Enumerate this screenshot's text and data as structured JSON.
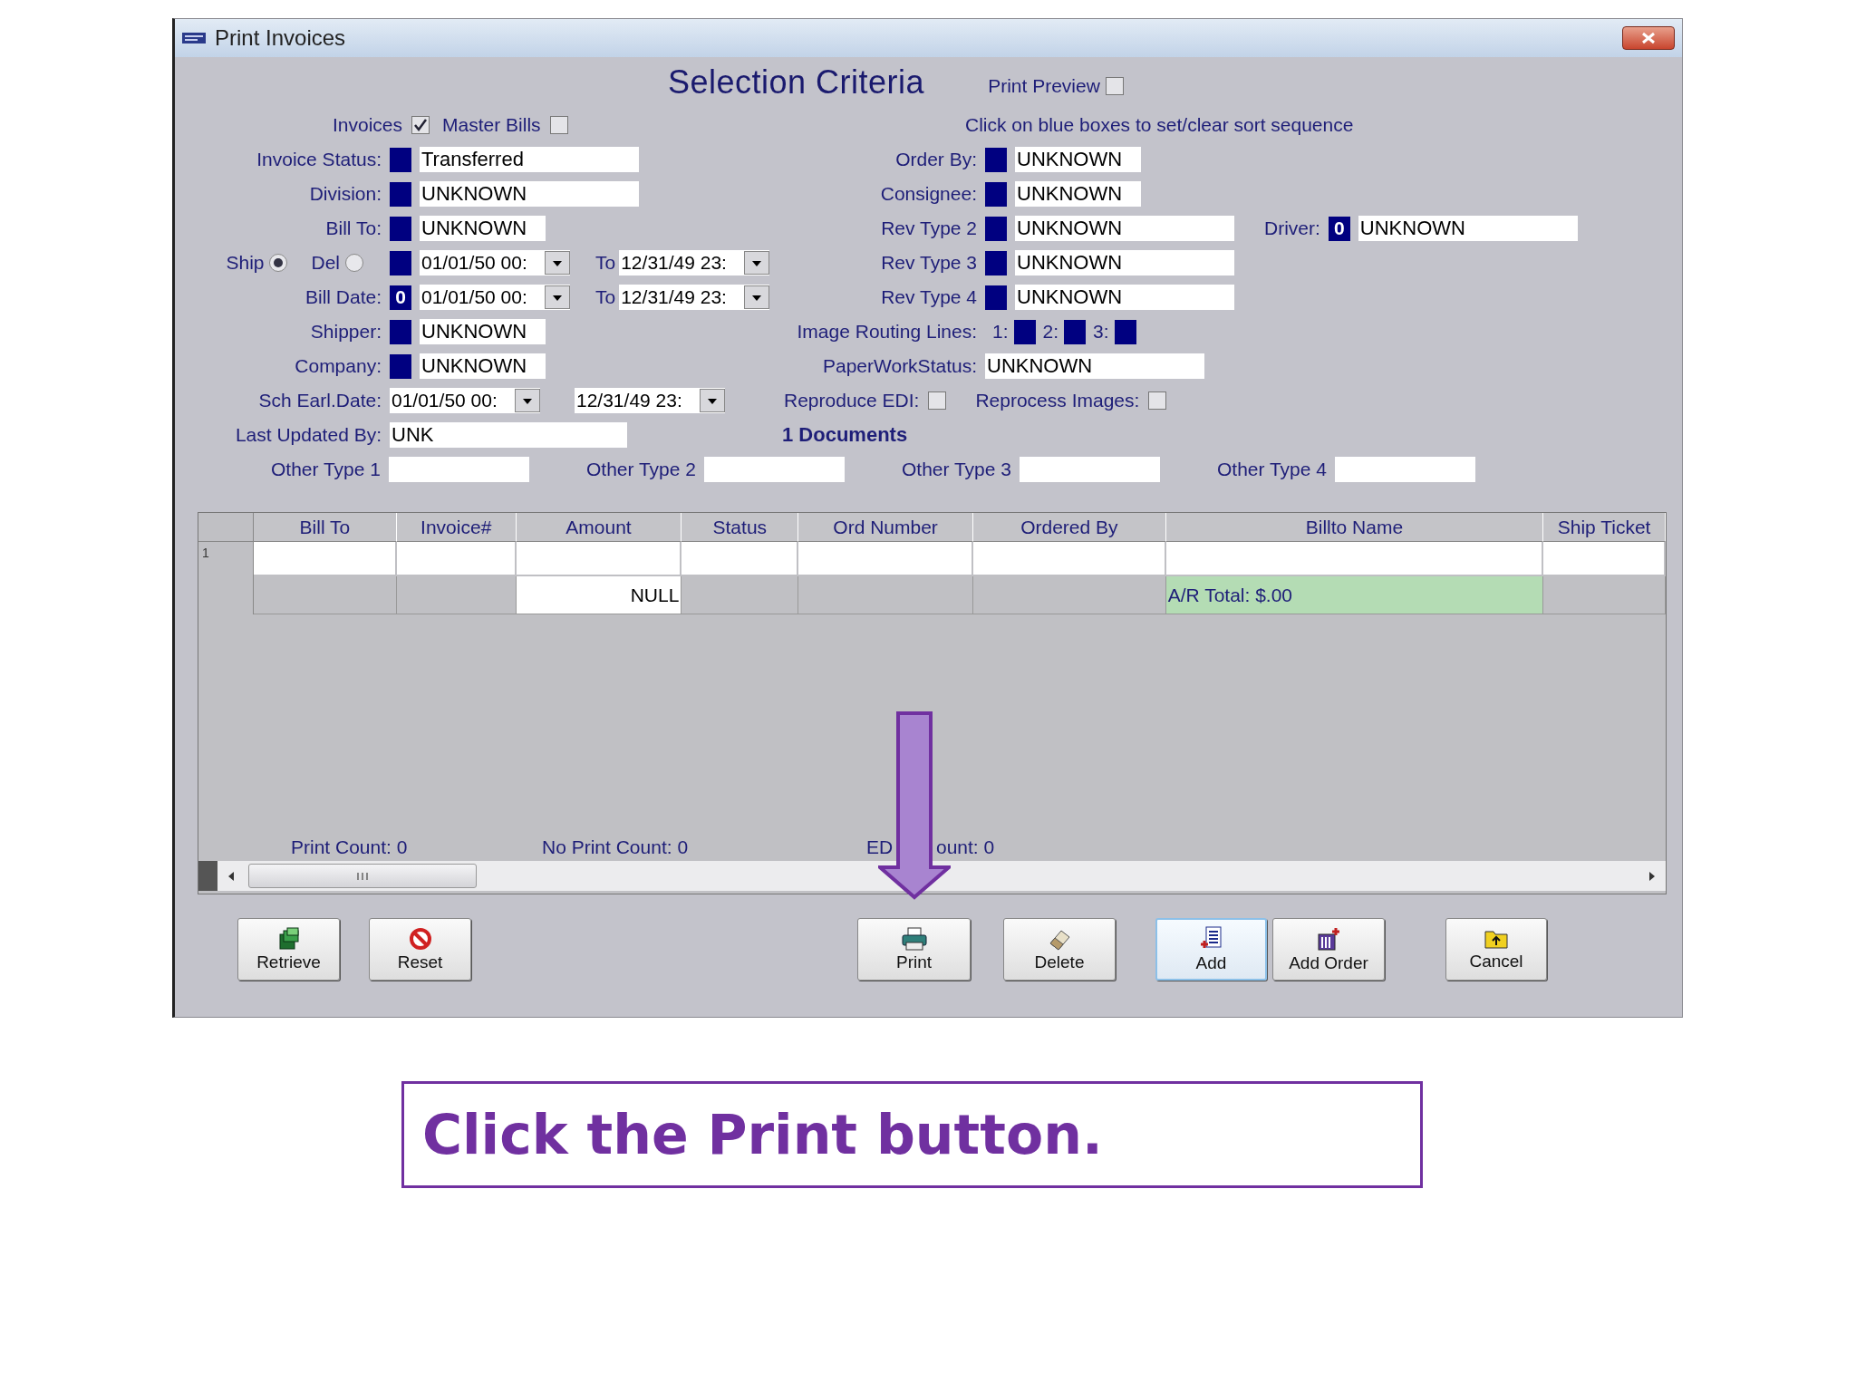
{
  "window": {
    "title": "Print Invoices"
  },
  "heading": "Selection Criteria",
  "print_preview": {
    "label": "Print Preview",
    "checked": false
  },
  "rows": [
    {
      "left": {
        "kind": "checks",
        "items": [
          {
            "label": "Invoices",
            "checked": true
          },
          {
            "label": "Master Bills",
            "checked": false
          }
        ]
      },
      "right": {
        "kind": "note",
        "text": "Click on blue boxes to set/clear sort sequence"
      }
    },
    {
      "left": {
        "kind": "field",
        "label": "Invoice Status:",
        "sort_box": true,
        "value": "Transferred",
        "wide": true
      },
      "right": {
        "kind": "field",
        "label": "Order By:",
        "sort_box": true,
        "value": "UNKNOWN",
        "wide": false
      }
    },
    {
      "left": {
        "kind": "field",
        "label": "Division:",
        "sort_box": true,
        "value": "UNKNOWN",
        "wide": true
      },
      "right": {
        "kind": "field",
        "label": "Consignee:",
        "sort_box": true,
        "value": "UNKNOWN",
        "wide": false
      }
    },
    {
      "left": {
        "kind": "field",
        "label": "Bill To:",
        "sort_box": true,
        "value": "UNKNOWN",
        "wide": false
      },
      "right": {
        "kind": "field",
        "label": "Rev Type 2",
        "sort_box": true,
        "value": "UNKNOWN",
        "wide": true
      },
      "extra": {
        "kind": "field",
        "label": "Driver:",
        "sort_box": true,
        "sort_order": "0",
        "value": "UNKNOWN",
        "wide": true
      }
    },
    {
      "left": {
        "kind": "dates",
        "radios": [
          {
            "label": "Ship",
            "selected": true
          },
          {
            "label": "Del",
            "selected": false
          }
        ],
        "sort_box": true,
        "from": "01/01/50 00:",
        "to_label": "To",
        "to": "12/31/49 23:"
      },
      "right": {
        "kind": "field",
        "label": "Rev Type 3",
        "sort_box": true,
        "value": "UNKNOWN",
        "wide": true
      }
    },
    {
      "left": {
        "kind": "dates",
        "label": "Bill Date:",
        "sort_box": true,
        "sort_order": "0",
        "from": "01/01/50 00:",
        "to_label": "To",
        "to": "12/31/49 23:"
      },
      "right": {
        "kind": "field",
        "label": "Rev Type 4",
        "sort_box": true,
        "value": "UNKNOWN",
        "wide": true
      }
    },
    {
      "left": {
        "kind": "field",
        "label": "Shipper:",
        "sort_box": true,
        "value": "UNKNOWN",
        "wide": false
      },
      "right": {
        "kind": "routing",
        "label": "Image Routing Lines:",
        "boxes": [
          {
            "label": "1:"
          },
          {
            "label": "2:"
          },
          {
            "label": "3:"
          }
        ]
      }
    },
    {
      "left": {
        "kind": "field",
        "label": "Company:",
        "sort_box": true,
        "value": "UNKNOWN",
        "wide": false
      },
      "right": {
        "kind": "field",
        "label": "PaperWorkStatus:",
        "sort_box": false,
        "value": "UNKNOWN",
        "wide": true
      }
    },
    {
      "left": {
        "kind": "dates",
        "label": "Sch Earl.Date:",
        "sort_box": false,
        "from": "01/01/50 00:",
        "to": "12/31/49 23:"
      },
      "right": {
        "kind": "checks",
        "items": [
          {
            "label": "Reproduce EDI:",
            "checked": false
          },
          {
            "label": "Reprocess Images:",
            "checked": false
          }
        ]
      }
    },
    {
      "left": {
        "kind": "field",
        "label": "Last Updated By:",
        "sort_box": false,
        "value": "UNK",
        "wide": true
      },
      "right": {
        "kind": "count",
        "text": "1 Documents"
      }
    }
  ],
  "other_types": [
    {
      "label": "Other Type 1"
    },
    {
      "label": "Other Type 2"
    },
    {
      "label": "Other Type 3"
    },
    {
      "label": "Other Type 4"
    }
  ],
  "table": {
    "columns": [
      "Bill To",
      "Invoice#",
      "Amount",
      "Status",
      "Ord Number",
      "Ordered By",
      "Billto Name",
      "Ship Ticket"
    ],
    "rows": [
      {
        "number": "1"
      }
    ],
    "totals": [
      {
        "kind": "plain"
      },
      {
        "kind": "plain"
      },
      {
        "kind": "value",
        "text": "NULL"
      },
      {
        "kind": "plain"
      },
      {
        "kind": "plain"
      },
      {
        "kind": "plain"
      },
      {
        "kind": "total",
        "text": "A/R Total: $.00"
      },
      {
        "kind": "plain"
      }
    ]
  },
  "counts": [
    "Print Count: 0",
    "No Print Count: 0",
    "ED",
    "ount: 0"
  ],
  "buttons": [
    {
      "label": "Retrieve",
      "kind": "retrieve",
      "focused": false
    },
    {
      "label": "Reset",
      "kind": "reset",
      "focused": false
    },
    {
      "label": "Print",
      "kind": "print",
      "focused": false
    },
    {
      "label": "Delete",
      "kind": "delete",
      "focused": false
    },
    {
      "label": "Add",
      "kind": "add",
      "focused": true
    },
    {
      "label": "Add Order",
      "kind": "add_order",
      "focused": false
    },
    {
      "label": "Cancel",
      "kind": "cancel",
      "focused": false
    }
  ],
  "caption": "Click the Print button."
}
